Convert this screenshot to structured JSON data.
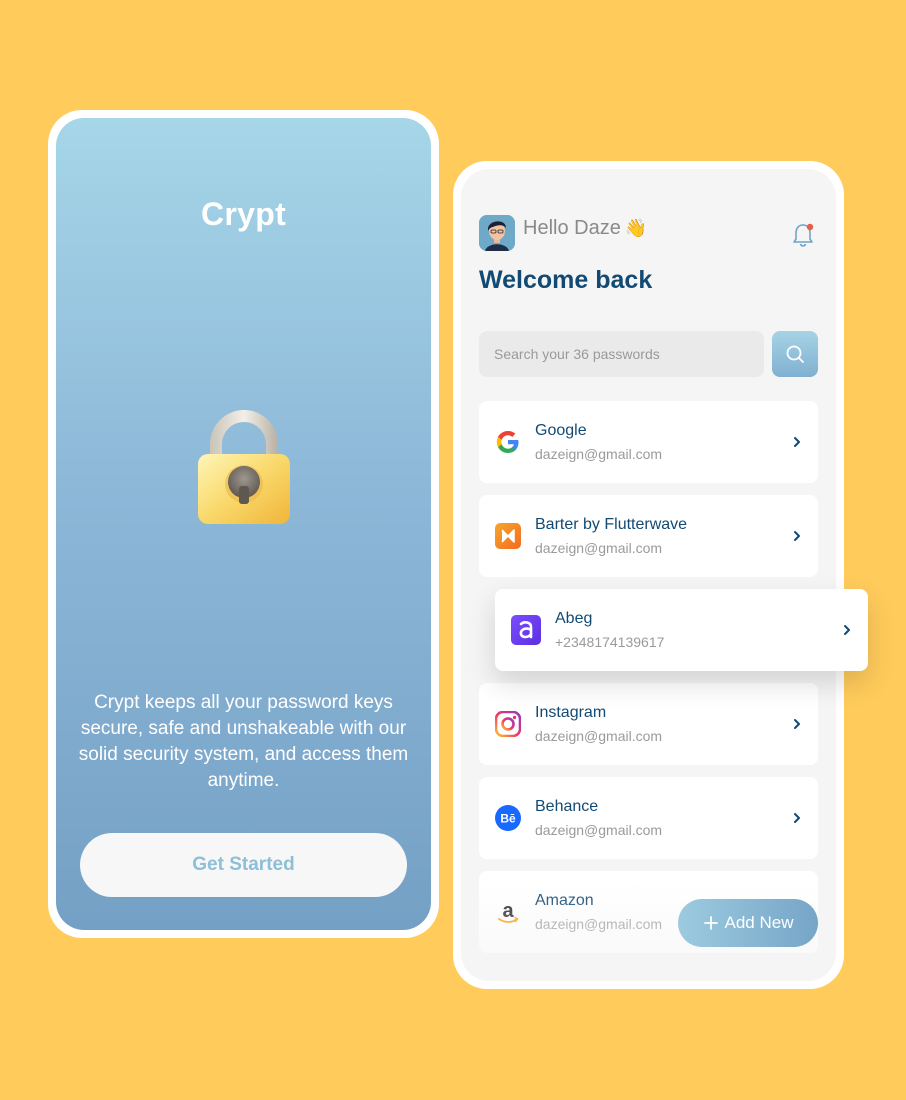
{
  "onboarding": {
    "app_title": "Crypt",
    "tagline": "Crypt keeps all your password keys secure, safe and unshakeable with our solid security system, and access them anytime.",
    "cta_label": "Get Started"
  },
  "dashboard": {
    "greeting": "Hello Daze",
    "greeting_emoji": "👋",
    "welcome": "Welcome back",
    "search_placeholder": "Search your 36 passwords",
    "items": [
      {
        "name": "Google",
        "sub": "dazeign@gmail.com",
        "icon": "google-icon"
      },
      {
        "name": "Barter by Flutterwave",
        "sub": "dazeign@gmail.com",
        "icon": "barter-icon"
      },
      {
        "name": "Abeg",
        "sub": "+2348174139617",
        "icon": "abeg-icon"
      },
      {
        "name": "Instagram",
        "sub": "dazeign@gmail.com",
        "icon": "instagram-icon"
      },
      {
        "name": "Behance",
        "sub": "dazeign@gmail.com",
        "icon": "behance-icon"
      },
      {
        "name": "Amazon",
        "sub": "dazeign@gmail.com",
        "icon": "amazon-icon"
      }
    ],
    "add_new_label": "Add New"
  },
  "colors": {
    "background": "#FFCB5B",
    "primary_text": "#124A73",
    "accent": "#8DBFD6"
  }
}
